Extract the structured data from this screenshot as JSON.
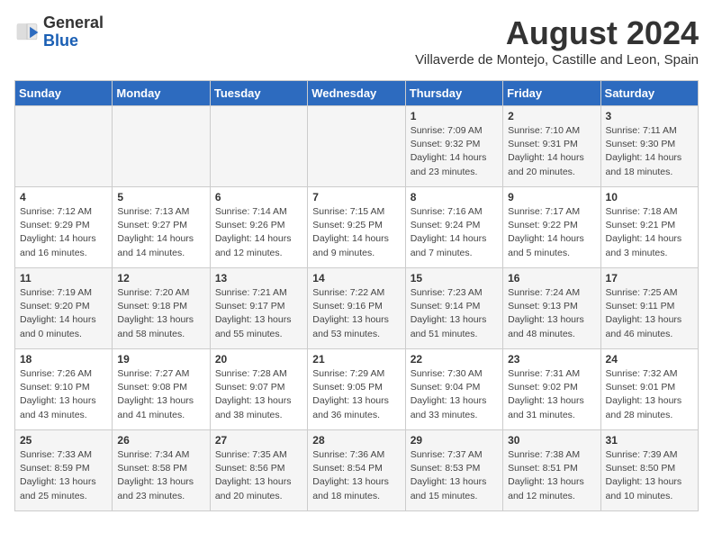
{
  "header": {
    "logo_general": "General",
    "logo_blue": "Blue",
    "month_title": "August 2024",
    "subtitle": "Villaverde de Montejo, Castille and Leon, Spain"
  },
  "days_of_week": [
    "Sunday",
    "Monday",
    "Tuesday",
    "Wednesday",
    "Thursday",
    "Friday",
    "Saturday"
  ],
  "weeks": [
    [
      {
        "day": "",
        "info": ""
      },
      {
        "day": "",
        "info": ""
      },
      {
        "day": "",
        "info": ""
      },
      {
        "day": "",
        "info": ""
      },
      {
        "day": "1",
        "info": "Sunrise: 7:09 AM\nSunset: 9:32 PM\nDaylight: 14 hours\nand 23 minutes."
      },
      {
        "day": "2",
        "info": "Sunrise: 7:10 AM\nSunset: 9:31 PM\nDaylight: 14 hours\nand 20 minutes."
      },
      {
        "day": "3",
        "info": "Sunrise: 7:11 AM\nSunset: 9:30 PM\nDaylight: 14 hours\nand 18 minutes."
      }
    ],
    [
      {
        "day": "4",
        "info": "Sunrise: 7:12 AM\nSunset: 9:29 PM\nDaylight: 14 hours\nand 16 minutes."
      },
      {
        "day": "5",
        "info": "Sunrise: 7:13 AM\nSunset: 9:27 PM\nDaylight: 14 hours\nand 14 minutes."
      },
      {
        "day": "6",
        "info": "Sunrise: 7:14 AM\nSunset: 9:26 PM\nDaylight: 14 hours\nand 12 minutes."
      },
      {
        "day": "7",
        "info": "Sunrise: 7:15 AM\nSunset: 9:25 PM\nDaylight: 14 hours\nand 9 minutes."
      },
      {
        "day": "8",
        "info": "Sunrise: 7:16 AM\nSunset: 9:24 PM\nDaylight: 14 hours\nand 7 minutes."
      },
      {
        "day": "9",
        "info": "Sunrise: 7:17 AM\nSunset: 9:22 PM\nDaylight: 14 hours\nand 5 minutes."
      },
      {
        "day": "10",
        "info": "Sunrise: 7:18 AM\nSunset: 9:21 PM\nDaylight: 14 hours\nand 3 minutes."
      }
    ],
    [
      {
        "day": "11",
        "info": "Sunrise: 7:19 AM\nSunset: 9:20 PM\nDaylight: 14 hours\nand 0 minutes."
      },
      {
        "day": "12",
        "info": "Sunrise: 7:20 AM\nSunset: 9:18 PM\nDaylight: 13 hours\nand 58 minutes."
      },
      {
        "day": "13",
        "info": "Sunrise: 7:21 AM\nSunset: 9:17 PM\nDaylight: 13 hours\nand 55 minutes."
      },
      {
        "day": "14",
        "info": "Sunrise: 7:22 AM\nSunset: 9:16 PM\nDaylight: 13 hours\nand 53 minutes."
      },
      {
        "day": "15",
        "info": "Sunrise: 7:23 AM\nSunset: 9:14 PM\nDaylight: 13 hours\nand 51 minutes."
      },
      {
        "day": "16",
        "info": "Sunrise: 7:24 AM\nSunset: 9:13 PM\nDaylight: 13 hours\nand 48 minutes."
      },
      {
        "day": "17",
        "info": "Sunrise: 7:25 AM\nSunset: 9:11 PM\nDaylight: 13 hours\nand 46 minutes."
      }
    ],
    [
      {
        "day": "18",
        "info": "Sunrise: 7:26 AM\nSunset: 9:10 PM\nDaylight: 13 hours\nand 43 minutes."
      },
      {
        "day": "19",
        "info": "Sunrise: 7:27 AM\nSunset: 9:08 PM\nDaylight: 13 hours\nand 41 minutes."
      },
      {
        "day": "20",
        "info": "Sunrise: 7:28 AM\nSunset: 9:07 PM\nDaylight: 13 hours\nand 38 minutes."
      },
      {
        "day": "21",
        "info": "Sunrise: 7:29 AM\nSunset: 9:05 PM\nDaylight: 13 hours\nand 36 minutes."
      },
      {
        "day": "22",
        "info": "Sunrise: 7:30 AM\nSunset: 9:04 PM\nDaylight: 13 hours\nand 33 minutes."
      },
      {
        "day": "23",
        "info": "Sunrise: 7:31 AM\nSunset: 9:02 PM\nDaylight: 13 hours\nand 31 minutes."
      },
      {
        "day": "24",
        "info": "Sunrise: 7:32 AM\nSunset: 9:01 PM\nDaylight: 13 hours\nand 28 minutes."
      }
    ],
    [
      {
        "day": "25",
        "info": "Sunrise: 7:33 AM\nSunset: 8:59 PM\nDaylight: 13 hours\nand 25 minutes."
      },
      {
        "day": "26",
        "info": "Sunrise: 7:34 AM\nSunset: 8:58 PM\nDaylight: 13 hours\nand 23 minutes."
      },
      {
        "day": "27",
        "info": "Sunrise: 7:35 AM\nSunset: 8:56 PM\nDaylight: 13 hours\nand 20 minutes."
      },
      {
        "day": "28",
        "info": "Sunrise: 7:36 AM\nSunset: 8:54 PM\nDaylight: 13 hours\nand 18 minutes."
      },
      {
        "day": "29",
        "info": "Sunrise: 7:37 AM\nSunset: 8:53 PM\nDaylight: 13 hours\nand 15 minutes."
      },
      {
        "day": "30",
        "info": "Sunrise: 7:38 AM\nSunset: 8:51 PM\nDaylight: 13 hours\nand 12 minutes."
      },
      {
        "day": "31",
        "info": "Sunrise: 7:39 AM\nSunset: 8:50 PM\nDaylight: 13 hours\nand 10 minutes."
      }
    ]
  ]
}
